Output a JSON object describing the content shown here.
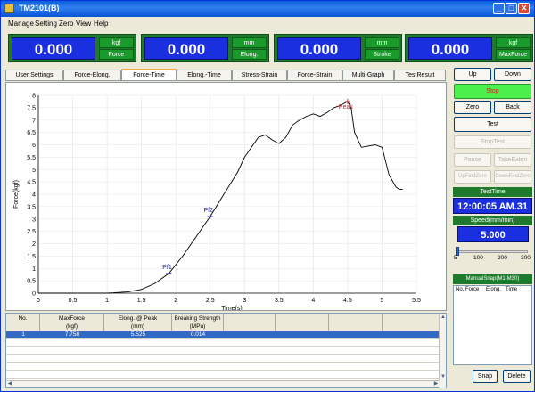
{
  "window": {
    "title": "TM2101(B)",
    "minimize": "_",
    "maximize": "□",
    "close": "✕"
  },
  "menu": [
    {
      "label": "Manage"
    },
    {
      "label": "Setting"
    },
    {
      "label": "Zero"
    },
    {
      "label": "View"
    },
    {
      "label": "Help"
    }
  ],
  "readouts": [
    {
      "value": "0.000",
      "unit": "kgf",
      "label": "Force"
    },
    {
      "value": "0.000",
      "unit": "mm",
      "label": "Elong."
    },
    {
      "value": "0.000",
      "unit": "mm",
      "label": "Stroke"
    },
    {
      "value": "0.000",
      "unit": "kgf",
      "label": "MaxForce"
    }
  ],
  "tabs": [
    {
      "label": "User Settings"
    },
    {
      "label": "Force-Elong."
    },
    {
      "label": "Force-Time",
      "active": true
    },
    {
      "label": "Elong.-Time"
    },
    {
      "label": "Stress-Strain"
    },
    {
      "label": "Force-Strain"
    },
    {
      "label": "Multi-Graph"
    },
    {
      "label": "TestResult"
    }
  ],
  "chart_data": {
    "type": "line",
    "xlabel": "Time(s)",
    "ylabel": "Force(kgf)",
    "xlim": [
      0,
      5.5
    ],
    "ylim": [
      0,
      8
    ],
    "xticks": [
      "0",
      "0.5",
      "1",
      "1.5",
      "2",
      "2.5",
      "3",
      "3.5",
      "4",
      "4.5",
      "5",
      "5.5"
    ],
    "yticks": [
      "0",
      "0.5",
      "1",
      "1.5",
      "2",
      "2.5",
      "3",
      "3.5",
      "4",
      "4.5",
      "5",
      "5.5",
      "6",
      "6.5",
      "7",
      "7.5",
      "8"
    ],
    "grid": true,
    "series": [
      {
        "color": "#000000",
        "x": [
          0,
          0.5,
          1.0,
          1.3,
          1.5,
          1.7,
          1.9,
          2.1,
          2.3,
          2.5,
          2.7,
          2.9,
          3.0,
          3.1,
          3.2,
          3.3,
          3.4,
          3.5,
          3.6,
          3.7,
          3.8,
          3.9,
          4.0,
          4.1,
          4.2,
          4.3,
          4.4,
          4.5,
          4.55,
          4.6,
          4.7,
          4.8,
          4.9,
          5.0,
          5.1,
          5.2,
          5.25,
          5.3
        ],
        "y": [
          0,
          0,
          0,
          0.05,
          0.15,
          0.4,
          0.8,
          1.5,
          2.3,
          3.1,
          4.0,
          4.9,
          5.5,
          5.9,
          6.3,
          6.4,
          6.2,
          6.05,
          6.3,
          6.8,
          7.0,
          7.15,
          7.25,
          7.15,
          7.3,
          7.5,
          7.6,
          7.75,
          7.5,
          6.5,
          5.9,
          5.95,
          6.0,
          5.9,
          4.8,
          4.3,
          4.2,
          4.2
        ]
      }
    ],
    "markers": [
      {
        "label": "Pf1",
        "x": 1.9,
        "y": 0.8,
        "color": "#1a1aa8"
      },
      {
        "label": "Pf2",
        "x": 2.5,
        "y": 3.1,
        "color": "#1a1aa8"
      },
      {
        "label": "Peak",
        "x": 4.5,
        "y": 7.75,
        "color": "#cc2020"
      }
    ]
  },
  "results_table": {
    "columns": [
      "No.",
      "MaxForce\n(kgf)",
      "Elong. @ Peak\n(mm)",
      "Breaking Strength\n(MPa)",
      "",
      "",
      "",
      ""
    ],
    "rows": [
      [
        "1",
        "7.758",
        "5.525",
        "0.014",
        "",
        "",
        "",
        ""
      ]
    ]
  },
  "side": {
    "up": "Up",
    "down": "Down",
    "stop": "Stop",
    "zero": "Zero",
    "back": "Back",
    "test": "Test",
    "stop_test": "StopTest",
    "pause": "Pause",
    "take_exten": "TakeExten",
    "up_find_zero": "UpFindZero",
    "down_find_zero": "DownFindZero",
    "test_time_label": "TestTime",
    "test_time_value": "12:00:05 AM.31",
    "speed_label": "Speed(mm/min)",
    "speed_value": "5.000",
    "speed_slider": {
      "min": 5,
      "max": 300,
      "value": 5
    },
    "speed_ticks": [
      "5",
      "100",
      "200",
      "300"
    ],
    "manual_snap_label": "ManualSnap(M1-M30)",
    "snap_columns": [
      "No.",
      "Force",
      "Elong.",
      "Time"
    ],
    "snap": "Snap",
    "delete": "Delete"
  }
}
